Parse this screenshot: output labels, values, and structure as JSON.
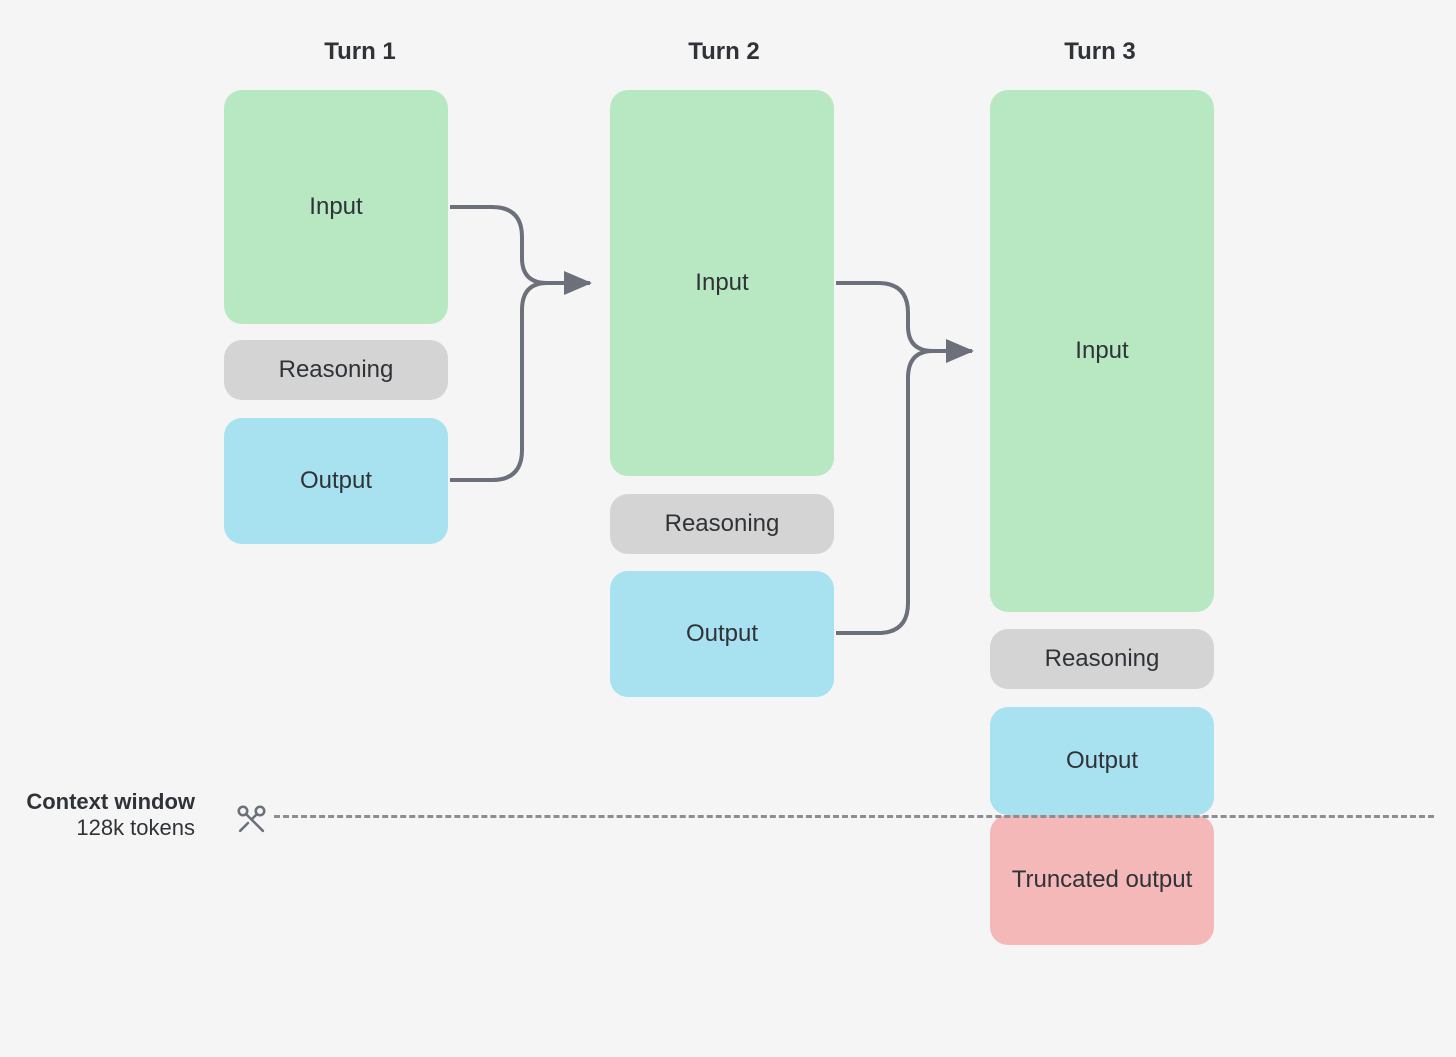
{
  "turns": [
    {
      "title": "Turn 1",
      "input": "Input",
      "reasoning": "Reasoning",
      "output": "Output"
    },
    {
      "title": "Turn 2",
      "input": "Input",
      "reasoning": "Reasoning",
      "output": "Output"
    },
    {
      "title": "Turn 3",
      "input": "Input",
      "reasoning": "Reasoning",
      "output": "Output",
      "truncated": "Truncated output"
    }
  ],
  "context": {
    "label_bold": "Context window",
    "label_sub": "128k tokens"
  },
  "colors": {
    "input": "#b8e8c2",
    "reasoning": "#d4d4d4",
    "output": "#a8e1f0",
    "truncated": "#f4b8b8",
    "arrow": "#6b707a",
    "dashed": "#8b8f94"
  }
}
